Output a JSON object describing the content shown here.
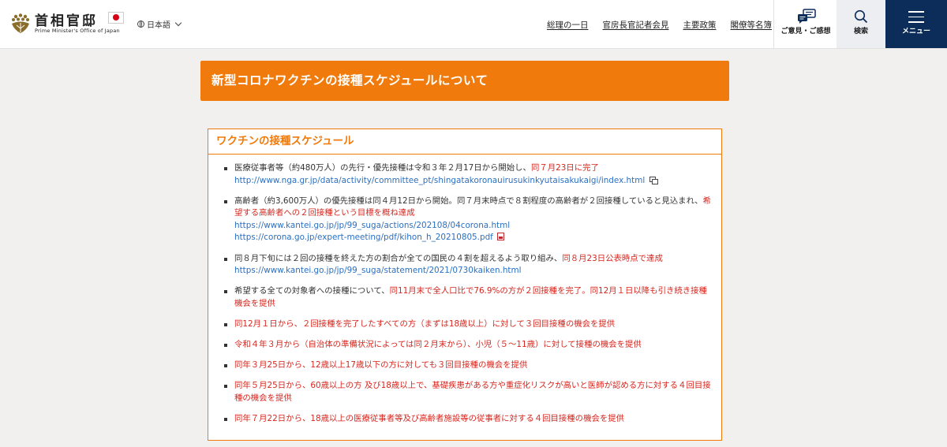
{
  "header": {
    "logo": {
      "name": "首相官邸",
      "english": "Prime Minister's Office of Japan"
    },
    "language": "日本語",
    "nav": [
      "総理の一日",
      "官房長官記者会見",
      "主要政策",
      "閣僚等名簿"
    ],
    "opinion_label": "ご意見・ご感想",
    "search_label": "検索",
    "menu_label": "メニュー"
  },
  "page": {
    "title": "新型コロナワクチンの接種スケジュールについて"
  },
  "panel": {
    "heading": "ワクチンの接種スケジュール",
    "items": [
      {
        "text": "医療従事者等（約480万人）の先行・優先接種は令和３年２月17日から開始し、",
        "red": "同７月23日に完了",
        "link1": "http://www.nga.gr.jp/data/activity/committee_pt/shingatakoronauirusukinkyutaisakukaigi/index.html"
      },
      {
        "text": "高齢者（約3,600万人）の優先接種は同４月12日から開始。同７月末時点で８割程度の高齢者が２回接種していると見込まれ、",
        "red": "希望する高齢者への２回接種という目標を概ね達成",
        "link1": "https://www.kantei.go.jp/jp/99_suga/actions/202108/04corona.html",
        "link2": "https://corona.go.jp/expert-meeting/pdf/kihon_h_20210805.pdf"
      },
      {
        "text": "同８月下旬には２回の接種を終えた方の割合が全ての国民の４割を超えるよう取り組み、",
        "red": "同８月23日公表時点で達成",
        "link1": "https://www.kantei.go.jp/jp/99_suga/statement/2021/0730kaiken.html"
      },
      {
        "text": "希望する全ての対象者への接種について、",
        "red": "同11月末で全人口比で76.9%の方が２回接種を完了。同12月１日以降も引き続き接種機会を提供"
      },
      {
        "red": "同12月１日から、２回接種を完了したすべての方（まずは18歳以上）に対して３回目接種の機会を提供"
      },
      {
        "red": "令和４年３月から（自治体の準備状況によっては同２月末から）、小児（５～11歳）に対して接種の機会を提供"
      },
      {
        "red": "同年３月25日から、12歳以上17歳以下の方に対しても３回目接種の機会を提供"
      },
      {
        "red": "同年５月25日から、60歳以上の方 及び18歳以上で、基礎疾患がある方や重症化リスクが高いと医師が認める方に対する４回目接種の機会を提供"
      },
      {
        "red": "同年７月22日から、18歳以上の医療従事者等及び高齢者施設等の従事者に対する４回目接種の機会を提供"
      }
    ]
  },
  "colors": {
    "accent": "#f07b0c",
    "red_text": "#d7261e",
    "link": "#2a6fc2",
    "menu_bg": "#0c2c5a"
  }
}
